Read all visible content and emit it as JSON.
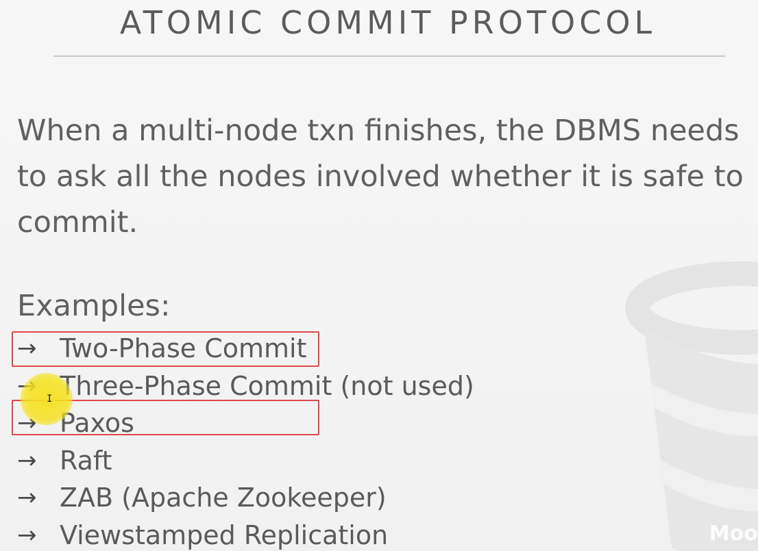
{
  "slide": {
    "title": "ATOMIC COMMIT PROTOCOL",
    "body": "When a multi-node txn finishes, the DBMS needs to ask all the nodes involved whether it is safe to commit.",
    "examples_label": "Examples:",
    "arrow": "→",
    "examples": [
      "Two-Phase Commit",
      "Three-Phase Commit (not used)",
      "Paxos",
      "Raft",
      "ZAB (Apache Zookeeper)",
      "Viewstamped Replication"
    ],
    "highlighted_items": [
      "Two-Phase Commit",
      "Paxos"
    ],
    "watermark": "Moo"
  },
  "colors": {
    "background": "#f4f4f4",
    "text": "#5e5e5e",
    "highlight_box": "#e0464a",
    "cursor_highlight": "#f5e11e"
  },
  "icons": {
    "background_logo": "database-cylinder-icon",
    "cursor": "text-cursor-icon"
  }
}
